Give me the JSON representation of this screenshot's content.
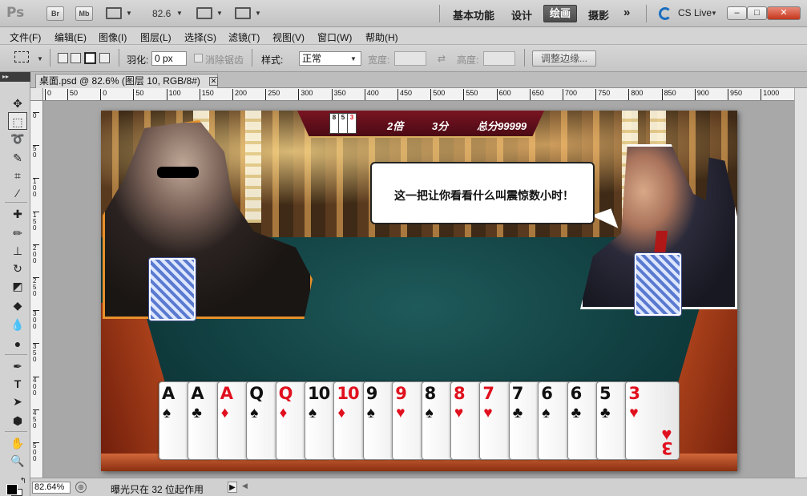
{
  "appbar": {
    "logo": "Ps",
    "bridge_label": "Br",
    "minibridge_label": "Mb",
    "zoom": "82.6",
    "workspaces": [
      "基本功能",
      "设计",
      "绘画",
      "摄影"
    ],
    "active_workspace": "绘画",
    "more": "»",
    "cslive": "CS Live",
    "window_buttons": [
      "–",
      "□",
      "✕"
    ]
  },
  "menu": {
    "items": [
      "文件(F)",
      "编辑(E)",
      "图像(I)",
      "图层(L)",
      "选择(S)",
      "滤镜(T)",
      "视图(V)",
      "窗口(W)",
      "帮助(H)"
    ]
  },
  "options": {
    "feather_label": "羽化:",
    "feather_value": "0 px",
    "antialias_label": "消除锯齿",
    "style_label": "样式:",
    "style_value": "正常",
    "width_label": "宽度:",
    "height_label": "高度:",
    "swap_icon": "⇄",
    "refine_button": "调整边缘..."
  },
  "document": {
    "tab_title": "桌面.psd @ 82.6% (图层 10, RGB/8#)",
    "close_glyph": "✕"
  },
  "ruler_h": [
    "0",
    "50",
    "0",
    "50",
    "100",
    "150",
    "200",
    "250",
    "300",
    "350",
    "400",
    "450",
    "500",
    "550",
    "600",
    "650",
    "700",
    "750",
    "800",
    "850",
    "900",
    "950",
    "1000"
  ],
  "ruler_v": [
    "0",
    "50",
    "100",
    "150",
    "200",
    "250",
    "300",
    "350",
    "400",
    "450",
    "500"
  ],
  "game": {
    "mini_cards": [
      "8",
      "5",
      "3"
    ],
    "multiplier": "2倍",
    "points": "3分",
    "total": "总分99999",
    "speech": "这一把让你看看什么叫震惊数小时！",
    "hand": [
      {
        "rank": "A",
        "suit": "♠",
        "color": "black"
      },
      {
        "rank": "A",
        "suit": "♣",
        "color": "black"
      },
      {
        "rank": "A",
        "suit": "♦",
        "color": "red"
      },
      {
        "rank": "Q",
        "suit": "♠",
        "color": "black"
      },
      {
        "rank": "Q",
        "suit": "♦",
        "color": "red"
      },
      {
        "rank": "10",
        "suit": "♠",
        "color": "black"
      },
      {
        "rank": "10",
        "suit": "♦",
        "color": "red"
      },
      {
        "rank": "9",
        "suit": "♠",
        "color": "black"
      },
      {
        "rank": "9",
        "suit": "♥",
        "color": "red"
      },
      {
        "rank": "8",
        "suit": "♠",
        "color": "black"
      },
      {
        "rank": "8",
        "suit": "♥",
        "color": "red"
      },
      {
        "rank": "7",
        "suit": "♥",
        "color": "red"
      },
      {
        "rank": "7",
        "suit": "♣",
        "color": "black"
      },
      {
        "rank": "6",
        "suit": "♠",
        "color": "black"
      },
      {
        "rank": "6",
        "suit": "♣",
        "color": "black"
      },
      {
        "rank": "5",
        "suit": "♣",
        "color": "black"
      },
      {
        "rank": "3",
        "suit": "♥",
        "color": "red"
      }
    ]
  },
  "status": {
    "zoom": "82.64%",
    "info_icon": "◎",
    "message": "曝光只在 32 位起作用",
    "arrow": "▶",
    "left_arrow": "◀"
  }
}
